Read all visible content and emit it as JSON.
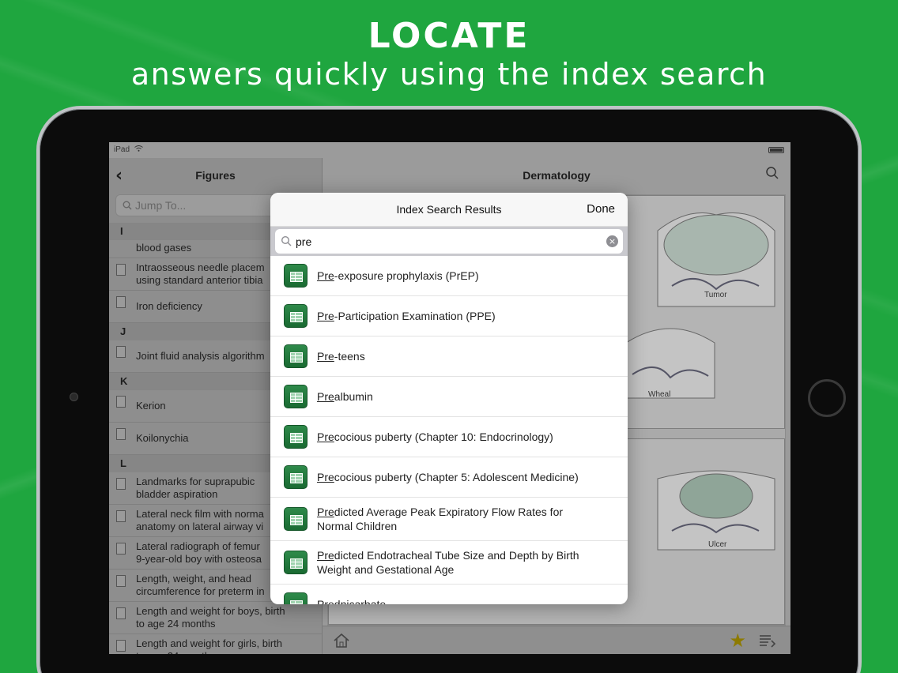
{
  "headline": {
    "title": "LOCATE",
    "subtitle": "answers quickly using the index search"
  },
  "status_bar": {
    "device": "iPad"
  },
  "left_pane": {
    "title": "Figures",
    "jump_placeholder": "Jump To...",
    "items": [
      {
        "type": "section",
        "label": "I"
      },
      {
        "type": "row",
        "label": "blood gases"
      },
      {
        "type": "row",
        "label": "Intraosseous needle placem",
        "label2": "using standard anterior tibia"
      },
      {
        "type": "row",
        "label": "Iron deficiency"
      },
      {
        "type": "section",
        "label": "J"
      },
      {
        "type": "row",
        "label": "Joint fluid analysis algorithm"
      },
      {
        "type": "section",
        "label": "K"
      },
      {
        "type": "row",
        "label": "Kerion"
      },
      {
        "type": "row",
        "label": "Koilonychia"
      },
      {
        "type": "section",
        "label": "L"
      },
      {
        "type": "row",
        "label": "Landmarks for suprapubic",
        "label2": "bladder aspiration"
      },
      {
        "type": "row",
        "label": "Lateral neck film with norma",
        "label2": "anatomy on lateral airway vi"
      },
      {
        "type": "row",
        "label": "Lateral radiograph of femur",
        "label2": "9-year-old boy with osteosa"
      },
      {
        "type": "row",
        "label": "Length, weight, and head",
        "label2": "circumference for preterm in"
      },
      {
        "type": "row",
        "label": "Length and weight for boys, birth",
        "label2": "to age 24 months"
      },
      {
        "type": "row",
        "label": "Length and weight for girls, birth",
        "label2": "to age 24 months"
      }
    ]
  },
  "right_pane": {
    "title": "Dermatology",
    "figure_labels": [
      "Tumor",
      "Wheal",
      "Ulcer"
    ]
  },
  "modal": {
    "title": "Index Search Results",
    "done_label": "Done",
    "search_value": "pre",
    "results": [
      {
        "match": "Pre",
        "rest": "-exposure prophylaxis (PrEP)"
      },
      {
        "match": "Pre",
        "rest": "-Participation Examination (PPE)"
      },
      {
        "match": "Pre",
        "rest": "-teens"
      },
      {
        "match": "Pre",
        "rest": "albumin"
      },
      {
        "match": "Pre",
        "rest": "cocious puberty (Chapter 10: Endocrinology)"
      },
      {
        "match": "Pre",
        "rest": "cocious puberty (Chapter 5: Adolescent Medicine)"
      },
      {
        "match": "Pre",
        "rest": "dicted Average Peak Expiratory Flow Rates for",
        "rest2": "Normal Children"
      },
      {
        "match": "Pre",
        "rest": "dicted Endotracheal Tube Size and Depth by Birth",
        "rest2": "Weight and Gestational Age"
      },
      {
        "match": "Pre",
        "rest": "dnicarbate"
      }
    ]
  },
  "colors": {
    "background": "#1fa63f",
    "result_icon": "#1f7a3c"
  },
  "icons": [
    "back-chevron-icon",
    "search-icon",
    "magnifier-icon",
    "clear-icon",
    "home-icon",
    "star-icon",
    "toc-icon",
    "document-icon",
    "table-icon",
    "wifi-icon",
    "battery-icon"
  ]
}
